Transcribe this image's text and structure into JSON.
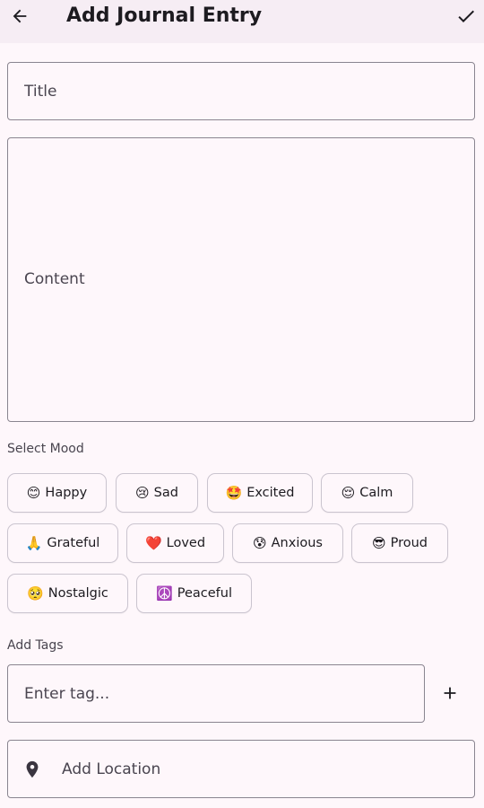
{
  "appbar": {
    "title": "Add Journal Entry",
    "back_icon": "arrow-left-icon",
    "save_icon": "check-icon"
  },
  "form": {
    "title_placeholder": "Title",
    "content_placeholder": "Content",
    "mood_label": "Select Mood",
    "moods": [
      {
        "emoji": "😊",
        "label": "Happy"
      },
      {
        "emoji": "😢",
        "label": "Sad"
      },
      {
        "emoji": "🤩",
        "label": "Excited"
      },
      {
        "emoji": "😌",
        "label": "Calm"
      },
      {
        "emoji": "🙏",
        "label": "Grateful"
      },
      {
        "emoji": "❤️",
        "label": "Loved"
      },
      {
        "emoji": "😰",
        "label": "Anxious"
      },
      {
        "emoji": "😎",
        "label": "Proud"
      },
      {
        "emoji": "🥺",
        "label": "Nostalgic"
      },
      {
        "emoji": "☮️",
        "label": "Peaceful"
      }
    ],
    "tags_label": "Add Tags",
    "tag_placeholder": "Enter tag...",
    "add_tag_icon": "plus-icon",
    "location_placeholder": "Add Location",
    "location_icon": "map-pin-icon"
  },
  "colors": {
    "background": "#fef7fb",
    "appbar": "#f6edf4",
    "border": "#8a8590",
    "chip_border": "#cac4cf"
  }
}
